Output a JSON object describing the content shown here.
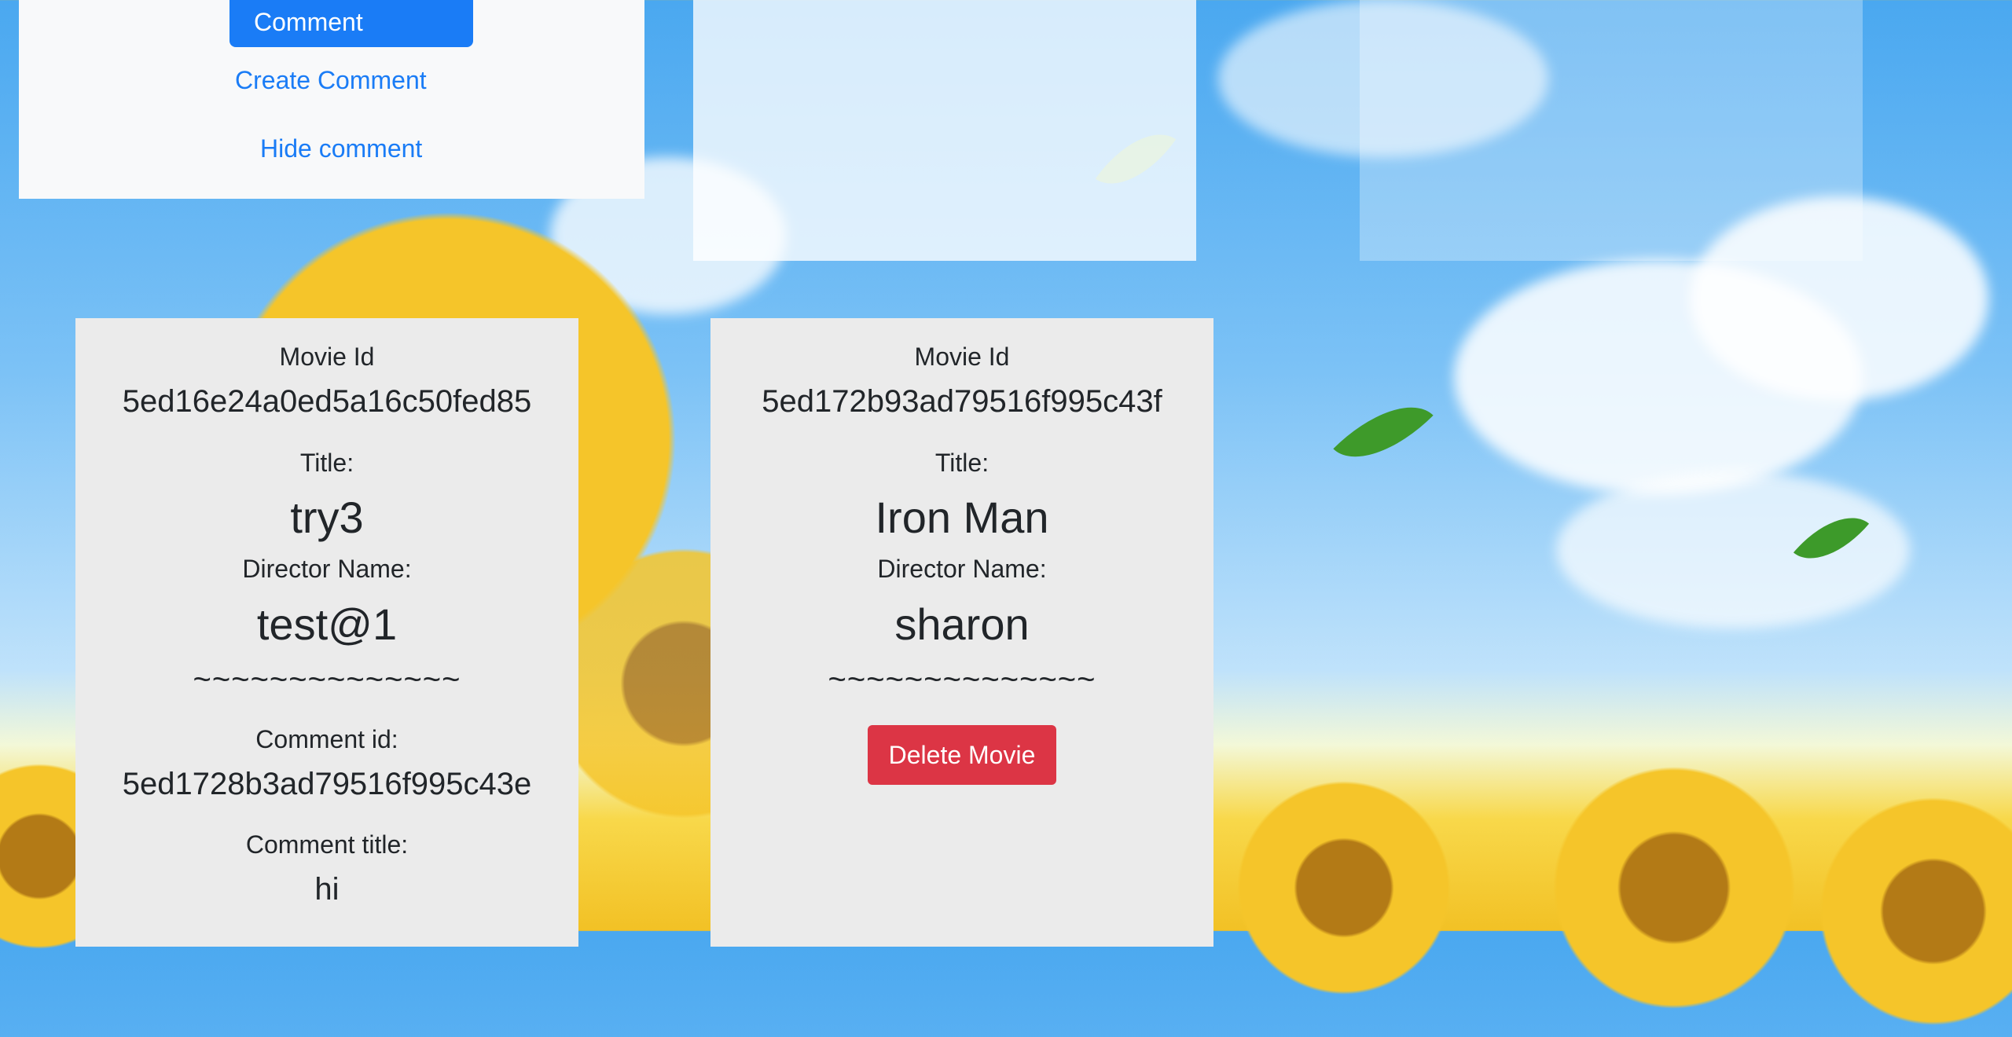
{
  "comment_panel": {
    "comment_button": "Comment",
    "create_comment_link": "Create Comment",
    "hide_comment_link": "Hide comment"
  },
  "cards": [
    {
      "movie_id_label": "Movie Id",
      "movie_id": "5ed16e24a0ed5a16c50fed85",
      "title_label": "Title:",
      "title": "try3",
      "director_label": "Director Name:",
      "director": "test@1",
      "separator": "~~~~~~~~~~~~~~",
      "comment_id_label": "Comment id:",
      "comment_id": "5ed1728b3ad79516f995c43e",
      "comment_title_label": "Comment title:",
      "comment_title": "hi"
    },
    {
      "movie_id_label": "Movie Id",
      "movie_id": "5ed172b93ad79516f995c43f",
      "title_label": "Title:",
      "title": "Iron Man",
      "director_label": "Director Name:",
      "director": "sharon",
      "separator": "~~~~~~~~~~~~~~",
      "delete_button": "Delete Movie"
    }
  ],
  "colors": {
    "primary": "#1a7cf6",
    "danger": "#dc3545",
    "card_bg": "#ebebeb",
    "text": "#212529"
  }
}
